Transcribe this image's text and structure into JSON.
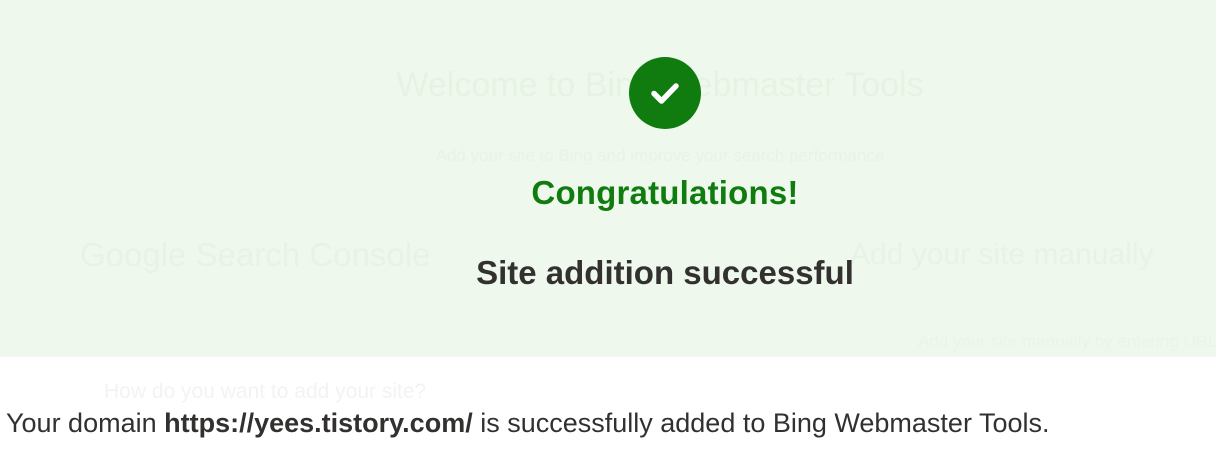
{
  "background": {
    "title": "Welcome to Bing Webmaster Tools",
    "subtitle": "Add your site to Bing and improve your search performance",
    "left_option": "Google Search Console",
    "right_option": "Add your site manually",
    "right_caption": "Add your site manually by entering URL",
    "bottom_text": "How do you want to add your site?"
  },
  "banner": {
    "icon": "checkmark-icon",
    "icon_color": "#107c10",
    "title": "Congratulations!",
    "subtitle": "Site addition successful"
  },
  "message": {
    "prefix": "Your domain ",
    "domain": "https://yees.tistory.com/",
    "suffix": " is successfully added to Bing Webmaster Tools."
  },
  "colors": {
    "success_green": "#107c10",
    "banner_bg": "#eff8ee",
    "text_dark": "#323130"
  }
}
